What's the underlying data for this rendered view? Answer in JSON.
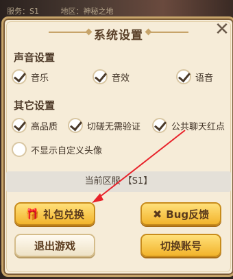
{
  "background": {
    "server": "服务：S1",
    "region": "地区：神秘之地"
  },
  "dialog": {
    "title": "系统设置",
    "close_label": "✕"
  },
  "sections": {
    "sound": {
      "heading": "声音设置",
      "options": [
        {
          "label": "音乐",
          "checked": true
        },
        {
          "label": "音效",
          "checked": true
        },
        {
          "label": "语音",
          "checked": true
        }
      ]
    },
    "other": {
      "heading": "其它设置",
      "options": [
        {
          "label": "高品质",
          "checked": true
        },
        {
          "label": "切磋无需验证",
          "checked": true
        },
        {
          "label": "公共聊天红点",
          "checked": true
        },
        {
          "label": "不显示自定义头像",
          "checked": false
        }
      ]
    }
  },
  "server_bar": {
    "text": "当前区服 【S1】"
  },
  "buttons": {
    "gift_exchange": {
      "label": "礼包兑换",
      "icon": "gift-icon"
    },
    "bug_feedback": {
      "label": "Bug反馈",
      "icon": "tools-icon"
    },
    "logout": {
      "label": "退出游戏"
    },
    "switch_account": {
      "label": "切换账号"
    }
  },
  "colors": {
    "panel": "#f6ecd8",
    "gold_button": "#f2b42c",
    "arrow": "#e8222a"
  }
}
